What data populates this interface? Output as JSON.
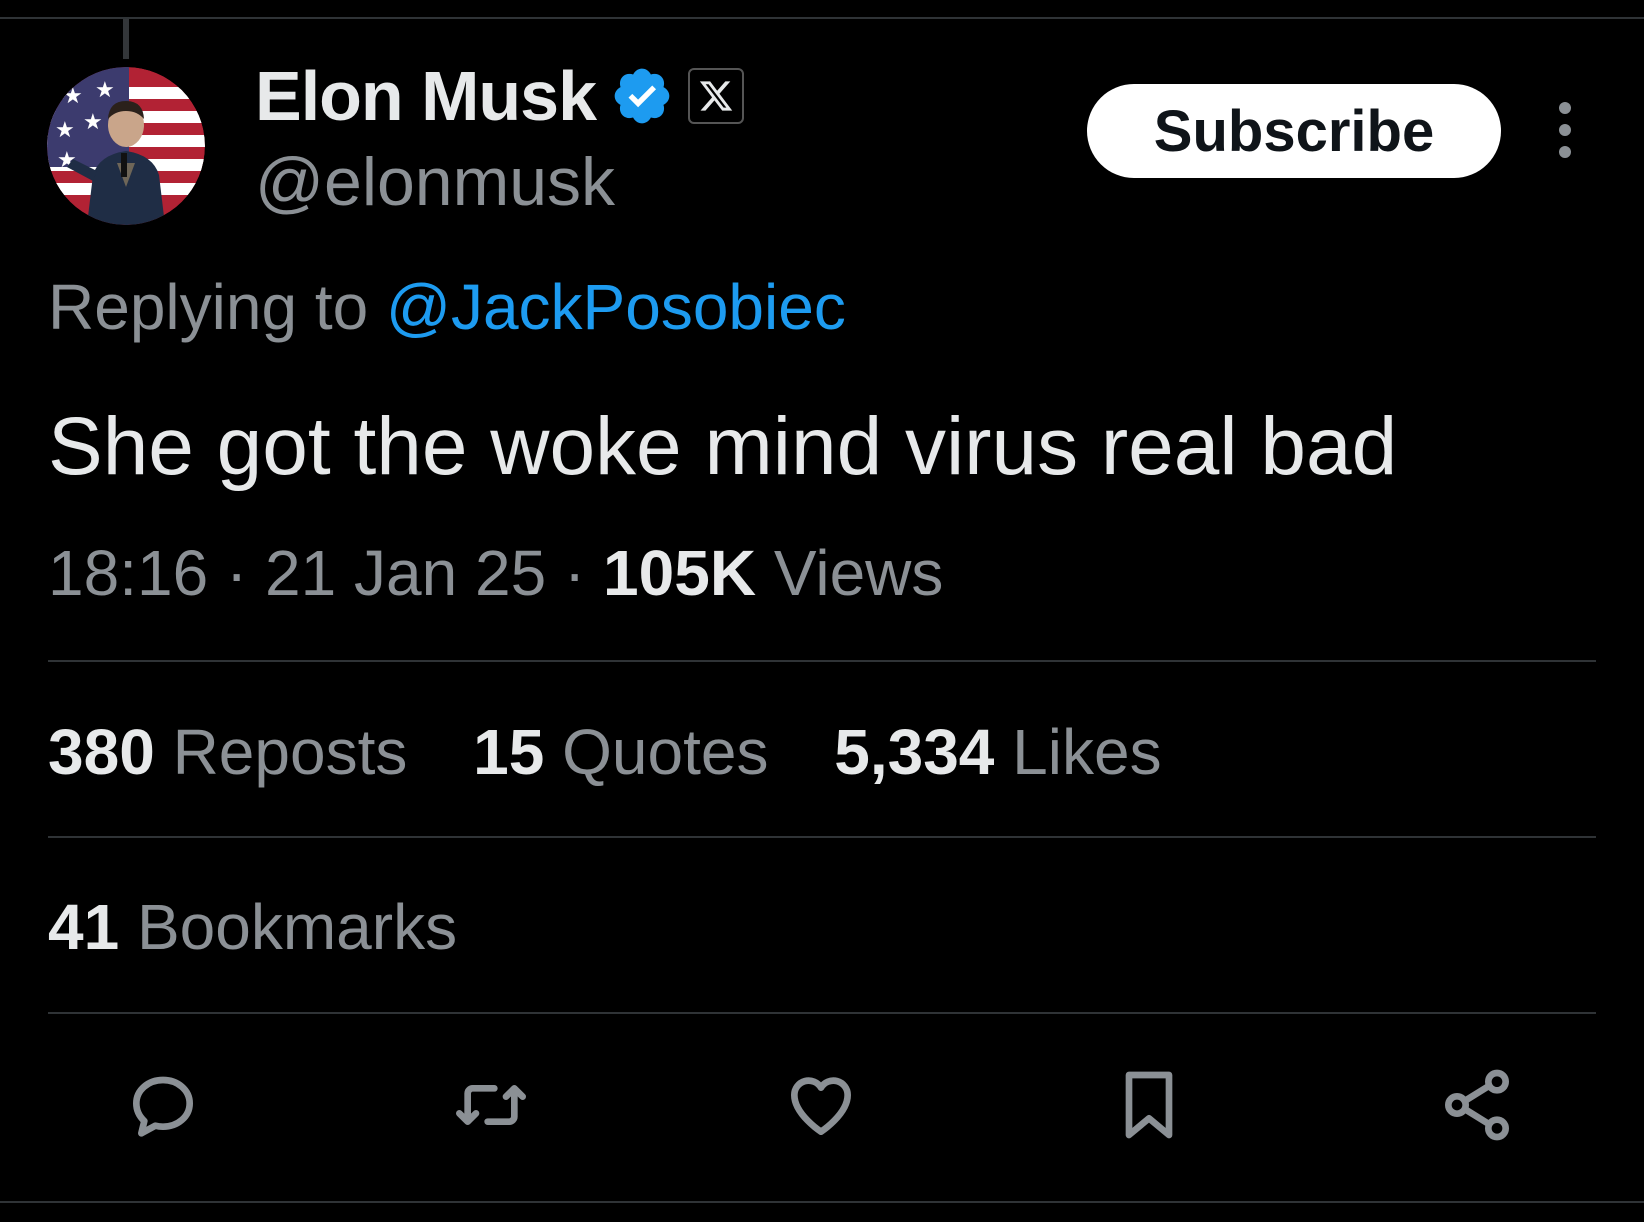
{
  "tweet": {
    "author": {
      "display_name": "Elon Musk",
      "handle": "@elonmusk",
      "verified": true,
      "affiliation_icon": "x-logo-icon",
      "avatar": "avatar-photo"
    },
    "subscribe_label": "Subscribe",
    "more_icon": "more-vertical-icon",
    "replying_to_prefix": "Replying to ",
    "replying_to_handle": "@JackPosobiec",
    "text": "She got the woke mind virus real bad",
    "time": "18:16",
    "date": "21 Jan 25",
    "separator": "·",
    "views_count": "105K",
    "views_label": "Views",
    "stats": {
      "reposts_count": "380",
      "reposts_label": "Reposts",
      "quotes_count": "15",
      "quotes_label": "Quotes",
      "likes_count": "5,334",
      "likes_label": "Likes",
      "bookmarks_count": "41",
      "bookmarks_label": "Bookmarks"
    },
    "actions": [
      {
        "name": "reply",
        "icon": "reply-icon"
      },
      {
        "name": "repost",
        "icon": "repost-icon"
      },
      {
        "name": "like",
        "icon": "heart-icon"
      },
      {
        "name": "bookmark",
        "icon": "bookmark-icon"
      },
      {
        "name": "share",
        "icon": "share-icon"
      }
    ]
  },
  "colors": {
    "background": "#000000",
    "text_primary": "#e7e9ea",
    "text_secondary": "#8b9095",
    "link": "#1d9bf0",
    "divider": "#2f3336",
    "verified_badge": "#1d9bf0"
  }
}
